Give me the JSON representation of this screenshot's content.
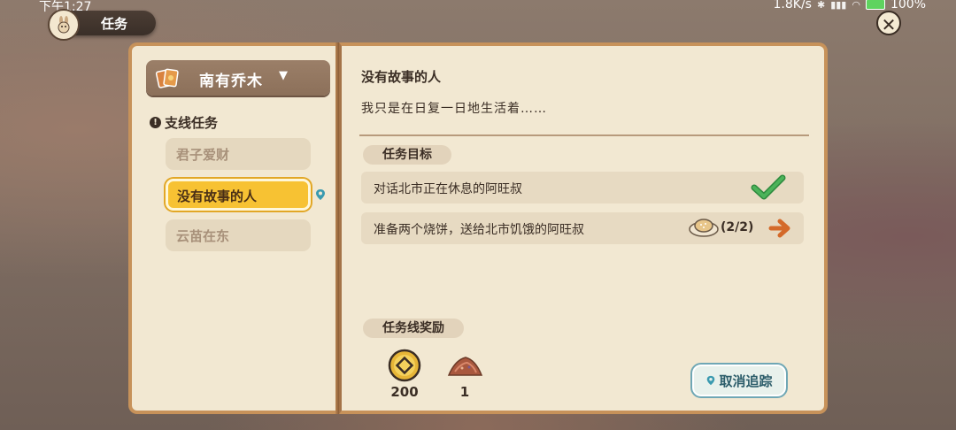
{
  "status_bar": {
    "time": "下午1:27",
    "network_speed": "1.8K/s",
    "battery": "100%"
  },
  "header": {
    "title": "任务",
    "icon": "bunny-icon"
  },
  "close_icon": "close-icon",
  "sidebar": {
    "region": "南有乔木",
    "section": "支线任务",
    "quests": [
      {
        "label": "君子爱财",
        "active": false
      },
      {
        "label": "没有故事的人",
        "active": true
      },
      {
        "label": "云苗在东",
        "active": false
      }
    ]
  },
  "quest": {
    "title": "没有故事的人",
    "description": "我只是在日复一日地生活着……",
    "objectives_label": "任务目标",
    "objectives": [
      {
        "text": "对话北市正在休息的阿旺叔",
        "completed": true
      },
      {
        "text": "准备两个烧饼，送给北市饥饿的阿旺叔",
        "count": "(2/2)",
        "item_icon": "pancake-icon"
      }
    ],
    "rewards_label": "任务线奖励",
    "rewards": [
      {
        "icon": "coin-icon",
        "amount": "200"
      },
      {
        "icon": "ore-icon",
        "amount": "1"
      }
    ],
    "untrack_button": "取消追踪"
  },
  "colors": {
    "accent": "#f7c233",
    "paper": "#f2e8d2",
    "border": "#c7925a",
    "track_button": "#6fa7b5"
  }
}
